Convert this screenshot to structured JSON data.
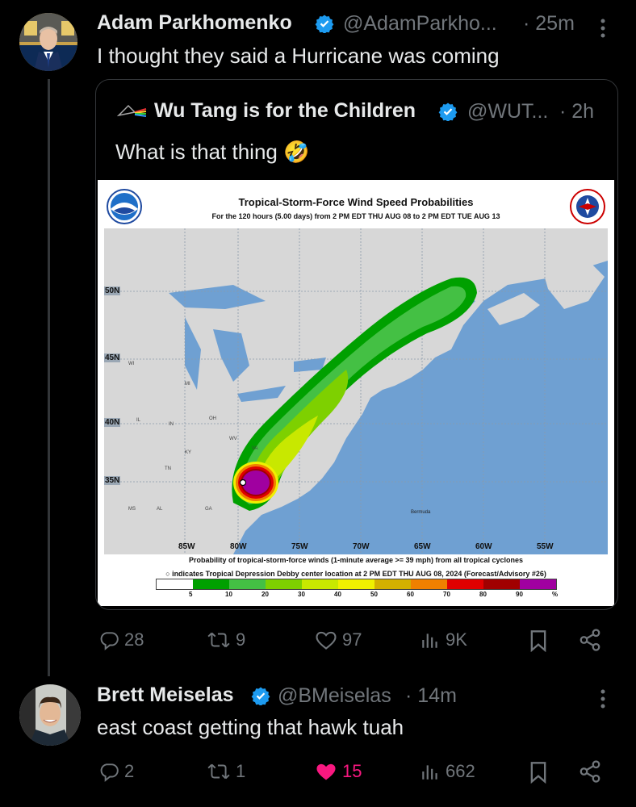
{
  "tweet1": {
    "author_name": "Adam Parkhomenko",
    "handle": "@AdamParkho...",
    "time": "· 25m",
    "text": "I thought they said a Hurricane was coming",
    "stats": {
      "replies": "28",
      "retweets": "9",
      "likes": "97",
      "views": "9K"
    }
  },
  "quote": {
    "author_name": "Wu Tang is for the Children",
    "handle": "@WUT...",
    "time": "· 2h",
    "text": "What is that thing 🤣",
    "map": {
      "title": "Tropical-Storm-Force Wind Speed Probabilities",
      "subtitle": "For the 120 hours (5.00 days) from 2 PM EDT THU AUG 08 to 2 PM EDT TUE AUG 13",
      "lat_labels": [
        "50N",
        "45N",
        "40N",
        "35N"
      ],
      "lon_labels": [
        "85W",
        "80W",
        "75W",
        "70W",
        "65W",
        "60W",
        "55W"
      ],
      "place_label": "Bermuda",
      "footer_line1": "Probability of tropical-storm-force winds (1-minute average >= 39 mph) from all tropical cyclones",
      "footer_line2": "indicates Tropical Depression Debby center location at 2 PM EDT THU AUG 08, 2024 (Forecast/Advisory #26)",
      "legend_values": [
        "5",
        "10",
        "20",
        "30",
        "40",
        "50",
        "60",
        "70",
        "80",
        "90",
        "%"
      ],
      "legend_colors": [
        "#ffffff",
        "#00a000",
        "#44c044",
        "#7ed000",
        "#c8e800",
        "#f0f000",
        "#d4b000",
        "#f08000",
        "#e00000",
        "#a00000",
        "#a000a0"
      ],
      "state_labels": [
        "WI",
        "MI",
        "IL",
        "IN",
        "OH",
        "KY",
        "WV",
        "VA",
        "TN",
        "MS",
        "AL",
        "GA"
      ]
    }
  },
  "tweet2": {
    "author_name": "Brett Meiselas",
    "handle": "@BMeiselas",
    "time": "· 14m",
    "text": "east coast getting that hawk tuah",
    "stats": {
      "replies": "2",
      "retweets": "1",
      "likes": "15",
      "views": "662"
    }
  },
  "colors": {
    "accent": "#1d9bf0",
    "like": "#f91880",
    "muted": "#71767b",
    "border": "#333639"
  }
}
